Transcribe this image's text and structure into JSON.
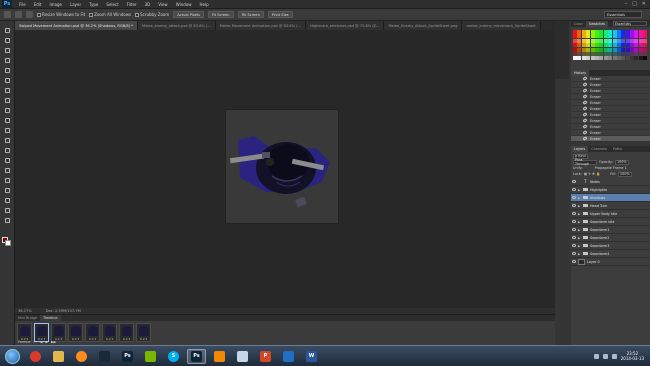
{
  "app": {
    "logo": "Ps"
  },
  "menu": [
    "File",
    "Edit",
    "Image",
    "Layer",
    "Type",
    "Select",
    "Filter",
    "3D",
    "View",
    "Window",
    "Help"
  ],
  "window_controls": [
    "–",
    "□",
    "✕"
  ],
  "options": {
    "checks": [
      "Resize Windows to Fit",
      "Zoom All Windows",
      "Scrubby Zoom"
    ],
    "buttons": [
      "Actual Pixels",
      "Fit Screen",
      "Fill Screen",
      "Print Size"
    ],
    "workspace": "Essentials"
  },
  "document_tabs": [
    "Swiped Movement Animation.psd @ 36.2% (Shadows, RGB/8) *",
    "Melee_enemy_attack.psd @ 83.6% (...",
    "Melee Movement Animation.psd @ 83.6% (...",
    "Highscore_stretches.psd @ 75.8% (E...",
    "Melee_Enemy_Attack_SpriteSheet.png",
    "melee_enemy_movement_SpriteSheet"
  ],
  "status": {
    "zoom": "36.17%",
    "doc": "Doc: 2.39M/107.7M"
  },
  "timeline": {
    "tabs": [
      "Mini Bridge",
      "Timeline"
    ],
    "frames": [
      {
        "num": "1",
        "delay": "0.2 ▾"
      },
      {
        "num": "2",
        "delay": "0.2 ▾"
      },
      {
        "num": "3",
        "delay": "0.2 ▾"
      },
      {
        "num": "4",
        "delay": "0.2 ▾"
      },
      {
        "num": "5",
        "delay": "0.2 ▾"
      },
      {
        "num": "6",
        "delay": "0.2 ▾"
      },
      {
        "num": "7",
        "delay": "0.2 ▾"
      },
      {
        "num": "8",
        "delay": "0.2 ▾"
      }
    ],
    "loop": "Forever"
  },
  "swatches_panel": {
    "tabs": [
      "Color",
      "Swatches"
    ],
    "preset": "Essentials"
  },
  "history_panel": {
    "tabs": [
      "History"
    ],
    "items": [
      "Eraser",
      "Eraser",
      "Eraser",
      "Eraser",
      "Eraser",
      "Eraser",
      "Eraser",
      "Eraser",
      "Eraser",
      "Eraser",
      "Eraser"
    ]
  },
  "layers_panel": {
    "tabs": [
      "Layers",
      "Channels",
      "Paths"
    ],
    "kind": "ρ Kind",
    "blend": "Pass Through",
    "opacity_label": "Opacity:",
    "opacity": "100%",
    "lock_label": "Lock:",
    "fill_label": "Fill:",
    "fill": "100%",
    "propagate": "Propagate Frame 1",
    "unify": "Unify:",
    "layers": [
      {
        "name": "Notes",
        "type": "text"
      },
      {
        "name": "Highlights",
        "type": "folder"
      },
      {
        "name": "Shadows",
        "type": "folder",
        "selected": true
      },
      {
        "name": "Head Turn",
        "type": "folder"
      },
      {
        "name": "Upper Body Idle",
        "type": "folder"
      },
      {
        "name": "Swordarm Idle",
        "type": "folder"
      },
      {
        "name": "Swordarm1",
        "type": "folder"
      },
      {
        "name": "Swordarm2",
        "type": "folder"
      },
      {
        "name": "Swordarm3",
        "type": "folder"
      },
      {
        "name": "Swordarm4",
        "type": "folder"
      },
      {
        "name": "Layer 0",
        "type": "pixel"
      }
    ]
  },
  "taskbar": {
    "apps": [
      {
        "name": "chrome",
        "label": "",
        "color": "#d93a2b"
      },
      {
        "name": "explorer",
        "label": "",
        "color": "#e5b84c"
      },
      {
        "name": "itunes",
        "label": "",
        "color": "#ff8c1a"
      },
      {
        "name": "steam",
        "label": "",
        "color": "#1b2838"
      },
      {
        "name": "photoshop-1",
        "label": "Ps",
        "color": "#0b2438"
      },
      {
        "name": "spotify",
        "label": "",
        "color": "#7ab800"
      },
      {
        "name": "skype",
        "label": "S",
        "color": "#00aff0"
      },
      {
        "name": "photoshop-2",
        "label": "Ps",
        "color": "#0b2438"
      },
      {
        "name": "vlc",
        "label": "",
        "color": "#f18a00"
      },
      {
        "name": "paint",
        "label": "",
        "color": "#c6d6e8"
      },
      {
        "name": "powerpoint",
        "label": "P",
        "color": "#d24726"
      },
      {
        "name": "media",
        "label": "",
        "color": "#1f6fc5"
      },
      {
        "name": "word",
        "label": "W",
        "color": "#2b579a"
      }
    ],
    "time": "23:52",
    "date": "2014-03-13"
  },
  "colors": {
    "foreground": "#8a0000",
    "background": "#ffffff",
    "selection": "#5a7fae"
  }
}
